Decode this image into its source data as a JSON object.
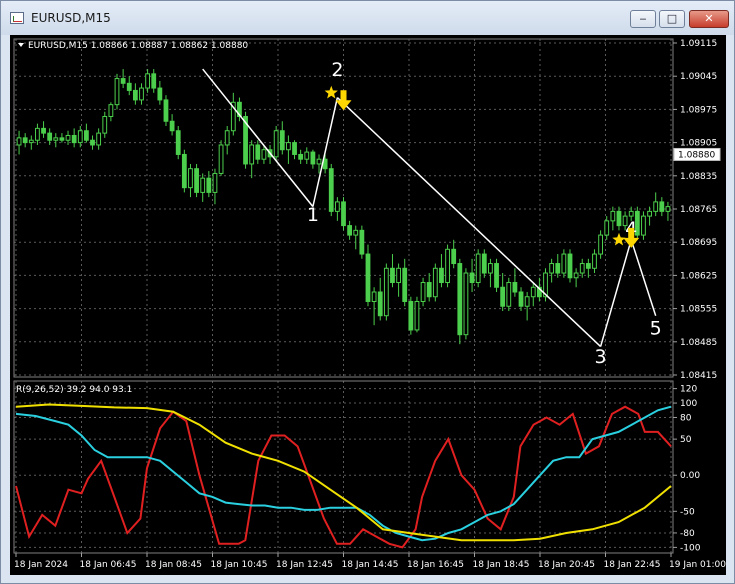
{
  "window": {
    "title": "EURUSD,M15",
    "controls": {
      "minimize": "‒",
      "maximize": "□",
      "close": "✕"
    }
  },
  "chart_data": [
    {
      "type": "candlestick",
      "header": "EURUSD,M15  1.08866 1.08887 1.08862 1.08880",
      "y_ticks": [
        "1.09115",
        "1.09045",
        "1.08975",
        "1.08905",
        "1.08835",
        "1.08765",
        "1.08695",
        "1.08625",
        "1.08555",
        "1.08485",
        "1.08415"
      ],
      "y_tick_values": [
        1.09115,
        1.09045,
        1.08975,
        1.08905,
        1.08835,
        1.08765,
        1.08695,
        1.08625,
        1.08555,
        1.08485,
        1.08415
      ],
      "ylim": [
        1.08415,
        1.09115
      ],
      "current_price": "1.08880",
      "current_price_value": 1.0888,
      "candles": [
        [
          1.089,
          1.0893,
          1.0888,
          1.08915
        ],
        [
          1.08915,
          1.08925,
          1.08895,
          1.08905
        ],
        [
          1.08905,
          1.0892,
          1.0889,
          1.0891
        ],
        [
          1.0891,
          1.08945,
          1.089,
          1.08935
        ],
        [
          1.08935,
          1.0895,
          1.08915,
          1.08925
        ],
        [
          1.08925,
          1.08935,
          1.089,
          1.0891
        ],
        [
          1.0891,
          1.08925,
          1.08895,
          1.08915
        ],
        [
          1.08915,
          1.08925,
          1.08905,
          1.0891
        ],
        [
          1.0891,
          1.0893,
          1.089,
          1.0892
        ],
        [
          1.0892,
          1.08935,
          1.08895,
          1.08905
        ],
        [
          1.08905,
          1.0894,
          1.08895,
          1.0893
        ],
        [
          1.0893,
          1.08945,
          1.08905,
          1.0891
        ],
        [
          1.0891,
          1.0892,
          1.0889,
          1.089
        ],
        [
          1.089,
          1.08935,
          1.0889,
          1.08925
        ],
        [
          1.08925,
          1.0897,
          1.08915,
          1.0896
        ],
        [
          1.0896,
          1.0899,
          1.0895,
          1.08985
        ],
        [
          1.08985,
          1.0905,
          1.08975,
          1.0904
        ],
        [
          1.0904,
          1.0906,
          1.0902,
          1.0903
        ],
        [
          1.0903,
          1.09045,
          1.09005,
          1.09015
        ],
        [
          1.09015,
          1.0903,
          1.08985,
          1.08995
        ],
        [
          1.08995,
          1.0903,
          1.08985,
          1.0902
        ],
        [
          1.0902,
          1.0906,
          1.0901,
          1.0905
        ],
        [
          1.0905,
          1.0906,
          1.0901,
          1.0902
        ],
        [
          1.0902,
          1.09035,
          1.08985,
          1.08995
        ],
        [
          1.08995,
          1.09005,
          1.0894,
          1.0895
        ],
        [
          1.0895,
          1.08965,
          1.0892,
          1.0893
        ],
        [
          1.0893,
          1.0894,
          1.0887,
          1.0888
        ],
        [
          1.0888,
          1.0889,
          1.088,
          1.0881
        ],
        [
          1.0881,
          1.0886,
          1.0879,
          1.0885
        ],
        [
          1.0885,
          1.0886,
          1.0879,
          1.088
        ],
        [
          1.088,
          1.0884,
          1.0878,
          1.0883
        ],
        [
          1.0883,
          1.08845,
          1.0879,
          1.088
        ],
        [
          1.088,
          1.0885,
          1.08775,
          1.0884
        ],
        [
          1.0884,
          1.0891,
          1.08835,
          1.089
        ],
        [
          1.089,
          1.0894,
          1.0888,
          1.0893
        ],
        [
          1.0893,
          1.0901,
          1.0892,
          1.0899
        ],
        [
          1.0899,
          1.09,
          1.0895,
          1.0896
        ],
        [
          1.0896,
          1.0897,
          1.0885,
          1.0886
        ],
        [
          1.0886,
          1.0891,
          1.0883,
          1.089
        ],
        [
          1.089,
          1.0891,
          1.0886,
          1.0887
        ],
        [
          1.0887,
          1.089,
          1.0886,
          1.0889
        ],
        [
          1.0889,
          1.089,
          1.0886,
          1.08875
        ],
        [
          1.08875,
          1.0894,
          1.08865,
          1.0893
        ],
        [
          1.0893,
          1.0895,
          1.0888,
          1.0889
        ],
        [
          1.0889,
          1.0892,
          1.0886,
          1.08905
        ],
        [
          1.08905,
          1.0891,
          1.0887,
          1.0888
        ],
        [
          1.0888,
          1.0889,
          1.0886,
          1.0887
        ],
        [
          1.0887,
          1.08895,
          1.0886,
          1.08885
        ],
        [
          1.08885,
          1.0889,
          1.0885,
          1.0886
        ],
        [
          1.0886,
          1.0888,
          1.0884,
          1.0887
        ],
        [
          1.0887,
          1.0888,
          1.0884,
          1.0885
        ],
        [
          1.0885,
          1.0886,
          1.0875,
          1.0876
        ],
        [
          1.0876,
          1.0879,
          1.0874,
          1.0878
        ],
        [
          1.0878,
          1.0879,
          1.0872,
          1.0873
        ],
        [
          1.0873,
          1.0874,
          1.087,
          1.0871
        ],
        [
          1.0871,
          1.0873,
          1.0868,
          1.0872
        ],
        [
          1.0872,
          1.0873,
          1.0866,
          1.0867
        ],
        [
          1.0867,
          1.0869,
          1.0856,
          1.0857
        ],
        [
          1.0857,
          1.086,
          1.0852,
          1.0859
        ],
        [
          1.0859,
          1.0862,
          1.0853,
          1.0854
        ],
        [
          1.0854,
          1.0865,
          1.0853,
          1.0864
        ],
        [
          1.0864,
          1.0867,
          1.086,
          1.0861
        ],
        [
          1.0861,
          1.0865,
          1.0858,
          1.0864
        ],
        [
          1.0864,
          1.0866,
          1.0856,
          1.0857
        ],
        [
          1.0857,
          1.0858,
          1.085,
          1.0851
        ],
        [
          1.0851,
          1.0858,
          1.08505,
          1.0857
        ],
        [
          1.0857,
          1.0862,
          1.0856,
          1.0861
        ],
        [
          1.0861,
          1.0863,
          1.0857,
          1.0858
        ],
        [
          1.0858,
          1.0865,
          1.0857,
          1.0864
        ],
        [
          1.0864,
          1.0867,
          1.086,
          1.0861
        ],
        [
          1.0861,
          1.0869,
          1.086,
          1.0868
        ],
        [
          1.0868,
          1.087,
          1.0864,
          1.0865
        ],
        [
          1.0865,
          1.0866,
          1.0848,
          1.085
        ],
        [
          1.085,
          1.0864,
          1.0849,
          1.0863
        ],
        [
          1.0863,
          1.0866,
          1.0859,
          1.0861
        ],
        [
          1.0861,
          1.0868,
          1.086,
          1.0867
        ],
        [
          1.0867,
          1.0868,
          1.0862,
          1.0863
        ],
        [
          1.0863,
          1.0866,
          1.086,
          1.0865
        ],
        [
          1.0865,
          1.0866,
          1.0859,
          1.086
        ],
        [
          1.086,
          1.0863,
          1.0855,
          1.0856
        ],
        [
          1.0856,
          1.0862,
          1.0855,
          1.0861
        ],
        [
          1.0861,
          1.0864,
          1.0858,
          1.0859
        ],
        [
          1.0859,
          1.086,
          1.0855,
          1.0856
        ],
        [
          1.0856,
          1.0859,
          1.0853,
          1.0858
        ],
        [
          1.0858,
          1.0861,
          1.0856,
          1.086
        ],
        [
          1.086,
          1.0862,
          1.0857,
          1.0858
        ],
        [
          1.0858,
          1.0864,
          1.0857,
          1.0863
        ],
        [
          1.0863,
          1.0866,
          1.0861,
          1.0865
        ],
        [
          1.0865,
          1.0867,
          1.0862,
          1.0863
        ],
        [
          1.0863,
          1.0868,
          1.0862,
          1.0867
        ],
        [
          1.0867,
          1.0868,
          1.0861,
          1.0862
        ],
        [
          1.0862,
          1.0864,
          1.086,
          1.0863
        ],
        [
          1.0863,
          1.0866,
          1.0862,
          1.0865
        ],
        [
          1.0865,
          1.0866,
          1.0862,
          1.0864
        ],
        [
          1.0864,
          1.0868,
          1.0863,
          1.0867
        ],
        [
          1.0867,
          1.0872,
          1.0866,
          1.0871
        ],
        [
          1.0871,
          1.0875,
          1.087,
          1.0874
        ],
        [
          1.0874,
          1.0877,
          1.0872,
          1.0876
        ],
        [
          1.0876,
          1.0877,
          1.0872,
          1.0873
        ],
        [
          1.0873,
          1.0876,
          1.0872,
          1.0875
        ],
        [
          1.0875,
          1.0877,
          1.0874,
          1.0876
        ],
        [
          1.0876,
          1.0877,
          1.087,
          1.0871
        ],
        [
          1.0871,
          1.0876,
          1.087,
          1.0875
        ],
        [
          1.0875,
          1.0877,
          1.0873,
          1.0876
        ],
        [
          1.0876,
          1.088,
          1.0875,
          1.0878
        ],
        [
          1.0878,
          1.0879,
          1.0875,
          1.0876
        ],
        [
          1.0876,
          1.0878,
          1.0874,
          1.0877
        ]
      ],
      "candle_colors": {
        "up": "#000000",
        "down": "#4ccf4c",
        "wick": "#4ccf4c",
        "up_outline": "#4ccf4c"
      },
      "zigzag": {
        "color": "#ffffff",
        "points": [
          [
            30,
            1.0906
          ],
          [
            48,
            1.0877
          ],
          [
            52,
            1.09
          ],
          [
            95,
            1.08475
          ],
          [
            100,
            1.087
          ],
          [
            104,
            1.0854
          ]
        ],
        "labels": [
          {
            "text": "2",
            "index": 52,
            "value": 1.09045
          },
          {
            "text": "1",
            "index": 48,
            "value": 1.0874
          },
          {
            "text": "4",
            "index": 100,
            "value": 1.0871
          },
          {
            "text": "3",
            "index": 95,
            "value": 1.0844
          },
          {
            "text": "5",
            "index": 104,
            "value": 1.085
          }
        ]
      },
      "markers": [
        {
          "type": "star",
          "index": 51,
          "value": 1.0901,
          "color": "#ffd700"
        },
        {
          "type": "arrow-down",
          "index": 53,
          "value": 1.0899,
          "color": "#ffd700"
        },
        {
          "type": "star",
          "index": 98,
          "value": 1.087,
          "color": "#ffd700"
        },
        {
          "type": "arrow-down",
          "index": 100,
          "value": 1.087,
          "color": "#ffd700"
        }
      ]
    },
    {
      "type": "line",
      "header": "R(9,26,52) 39.2 94.0 93.1",
      "y_ticks": [
        "120",
        "100",
        "80",
        "50",
        "0.00",
        "-50",
        "-80",
        "-100"
      ],
      "y_tick_values": [
        120,
        100,
        80,
        50,
        0,
        -50,
        -80,
        -100
      ],
      "ylim": [
        -105,
        125
      ],
      "x_labels": [
        "18 Jan 2024",
        "18 Jan 06:45",
        "18 Jan 08:45",
        "18 Jan 10:45",
        "18 Jan 12:45",
        "18 Jan 14:45",
        "18 Jan 16:45",
        "18 Jan 18:45",
        "18 Jan 20:45",
        "18 Jan 22:45",
        "19 Jan 01:00"
      ],
      "x_label_positions": [
        0,
        10,
        20,
        30,
        40,
        50,
        60,
        70,
        80,
        90,
        100
      ],
      "series": [
        {
          "color": "#e02020",
          "x": [
            0,
            2,
            4,
            6,
            8,
            10,
            11,
            13,
            15,
            17,
            19,
            20,
            22,
            24,
            26,
            28,
            31,
            34,
            35,
            37,
            39,
            41,
            43,
            45,
            47,
            49,
            51,
            53,
            55,
            57,
            59,
            61,
            62,
            64,
            66,
            68,
            70,
            72,
            74,
            76,
            77,
            79,
            81,
            83,
            85,
            87,
            89,
            91,
            93,
            95,
            96,
            98,
            100
          ],
          "values": [
            -15,
            -85,
            -55,
            -70,
            -20,
            -25,
            -5,
            20,
            -30,
            -80,
            -60,
            10,
            65,
            88,
            75,
            0,
            -95,
            -95,
            -90,
            20,
            55,
            55,
            40,
            -10,
            -60,
            -95,
            -95,
            -75,
            -85,
            -95,
            -100,
            -75,
            -30,
            20,
            50,
            0,
            -20,
            -60,
            -75,
            -30,
            40,
            70,
            80,
            70,
            85,
            30,
            40,
            85,
            95,
            85,
            60,
            60,
            40
          ]
        },
        {
          "color": "#2ad0e0",
          "x": [
            0,
            3,
            6,
            8,
            10,
            12,
            14,
            16,
            18,
            20,
            22,
            24,
            26,
            28,
            30,
            32,
            34,
            36,
            38,
            40,
            42,
            44,
            46,
            48,
            50,
            52,
            54,
            56,
            58,
            60,
            62,
            64,
            66,
            68,
            70,
            72,
            74,
            76,
            78,
            80,
            82,
            84,
            86,
            88,
            90,
            92,
            94,
            96,
            98,
            100
          ],
          "values": [
            85,
            82,
            75,
            70,
            55,
            35,
            25,
            25,
            25,
            25,
            20,
            5,
            -10,
            -25,
            -30,
            -38,
            -40,
            -42,
            -42,
            -45,
            -45,
            -48,
            -48,
            -45,
            -45,
            -45,
            -55,
            -70,
            -80,
            -85,
            -90,
            -88,
            -80,
            -75,
            -65,
            -55,
            -50,
            -40,
            -20,
            0,
            20,
            25,
            25,
            50,
            55,
            60,
            70,
            80,
            90,
            95
          ]
        },
        {
          "color": "#f0e000",
          "x": [
            0,
            5,
            10,
            15,
            20,
            24,
            28,
            32,
            36,
            40,
            44,
            48,
            52,
            56,
            60,
            64,
            68,
            72,
            76,
            80,
            84,
            88,
            92,
            96,
            100
          ],
          "values": [
            95,
            98,
            96,
            94,
            93,
            88,
            70,
            45,
            30,
            20,
            5,
            -20,
            -45,
            -75,
            -80,
            -85,
            -90,
            -90,
            -90,
            -88,
            -80,
            -75,
            -65,
            -45,
            -15
          ]
        }
      ]
    }
  ]
}
